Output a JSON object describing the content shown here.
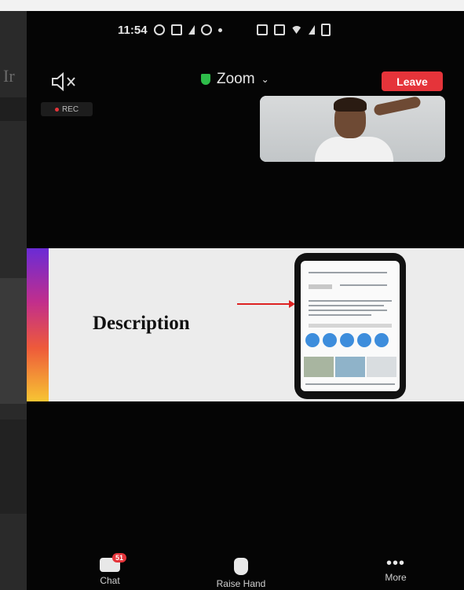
{
  "status_bar": {
    "time": "11:54"
  },
  "header": {
    "meeting_title": "Zoom",
    "leave_label": "Leave",
    "rec_label": "REC"
  },
  "slide": {
    "title": "Description"
  },
  "bottom_nav": {
    "chat_label": "Chat",
    "chat_badge": "51",
    "raise_hand_label": "Raise Hand",
    "more_label": "More"
  },
  "colors": {
    "leave": "#e5343a",
    "shield": "#2ebd4a",
    "background": "#050505"
  },
  "icons": [
    "whatsapp-icon",
    "message-icon",
    "telegram-icon",
    "chrome-icon",
    "wifi-icon",
    "signal-icon",
    "battery-icon",
    "speaker-off-icon",
    "shield-icon",
    "chevron-down-icon",
    "chat-icon",
    "raise-hand-icon",
    "more-icon"
  ]
}
